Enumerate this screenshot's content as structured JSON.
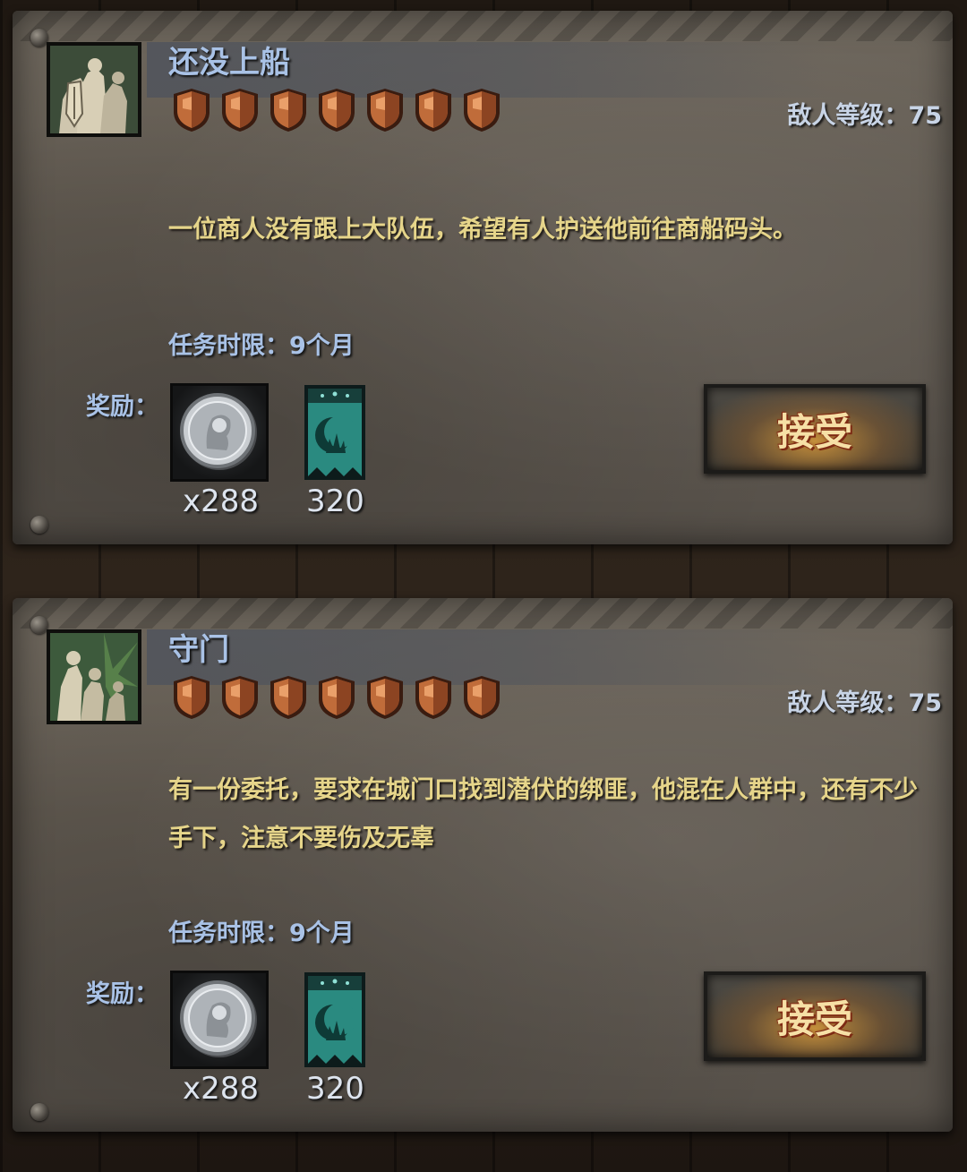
{
  "quests": [
    {
      "title": "还没上船",
      "difficulty_shields": 7,
      "enemy_level": "敌人等级：75",
      "description": "一位商人没有跟上大队伍，希望有人护送他前往商船码头。",
      "time_limit": "任务时限：9个月",
      "reward_label": "奖励：",
      "rewards": [
        {
          "icon": "silver-coin-icon",
          "amount": "x288"
        },
        {
          "icon": "moon-banner-icon",
          "amount": "320"
        }
      ],
      "accept_label": "接受",
      "icon": "knight-party-icon"
    },
    {
      "title": "守门",
      "difficulty_shields": 7,
      "enemy_level": "敌人等级：75",
      "description": "有一份委托，要求在城门口找到潜伏的绑匪，他混在人群中，还有不少手下，注意不要伤及无辜",
      "time_limit": "任务时限：9个月",
      "reward_label": "奖励：",
      "rewards": [
        {
          "icon": "silver-coin-icon",
          "amount": "x288"
        },
        {
          "icon": "moon-banner-icon",
          "amount": "320"
        }
      ],
      "accept_label": "接受",
      "icon": "ambush-party-icon"
    }
  ],
  "colors": {
    "title": "#a9c2e6",
    "description": "#e6d58a",
    "shield": "#b86a3c",
    "banner": "#2a8a80"
  }
}
